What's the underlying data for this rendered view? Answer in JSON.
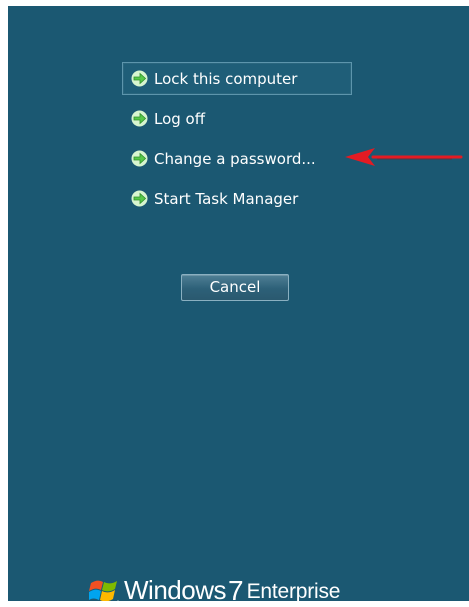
{
  "security_options": {
    "items": [
      {
        "label": "Lock this computer",
        "icon": "arrow-right-icon",
        "focused": true
      },
      {
        "label": "Log off",
        "icon": "arrow-right-icon",
        "focused": false
      },
      {
        "label": "Change a password...",
        "icon": "arrow-right-icon",
        "focused": false
      },
      {
        "label": "Start Task Manager",
        "icon": "arrow-right-icon",
        "focused": false
      }
    ],
    "cancel_label": "Cancel"
  },
  "annotation": {
    "arrow_color": "#e31b23",
    "points_to": "Change a password..."
  },
  "branding": {
    "logo": "windows-flag-icon",
    "windows_text": "Windows",
    "version_text": "7",
    "edition_text": "Enterprise"
  },
  "colors": {
    "background": "#1b5872",
    "text": "#ffffff",
    "icon_green": "#58c84a",
    "focus_border": "#5d95ac"
  }
}
